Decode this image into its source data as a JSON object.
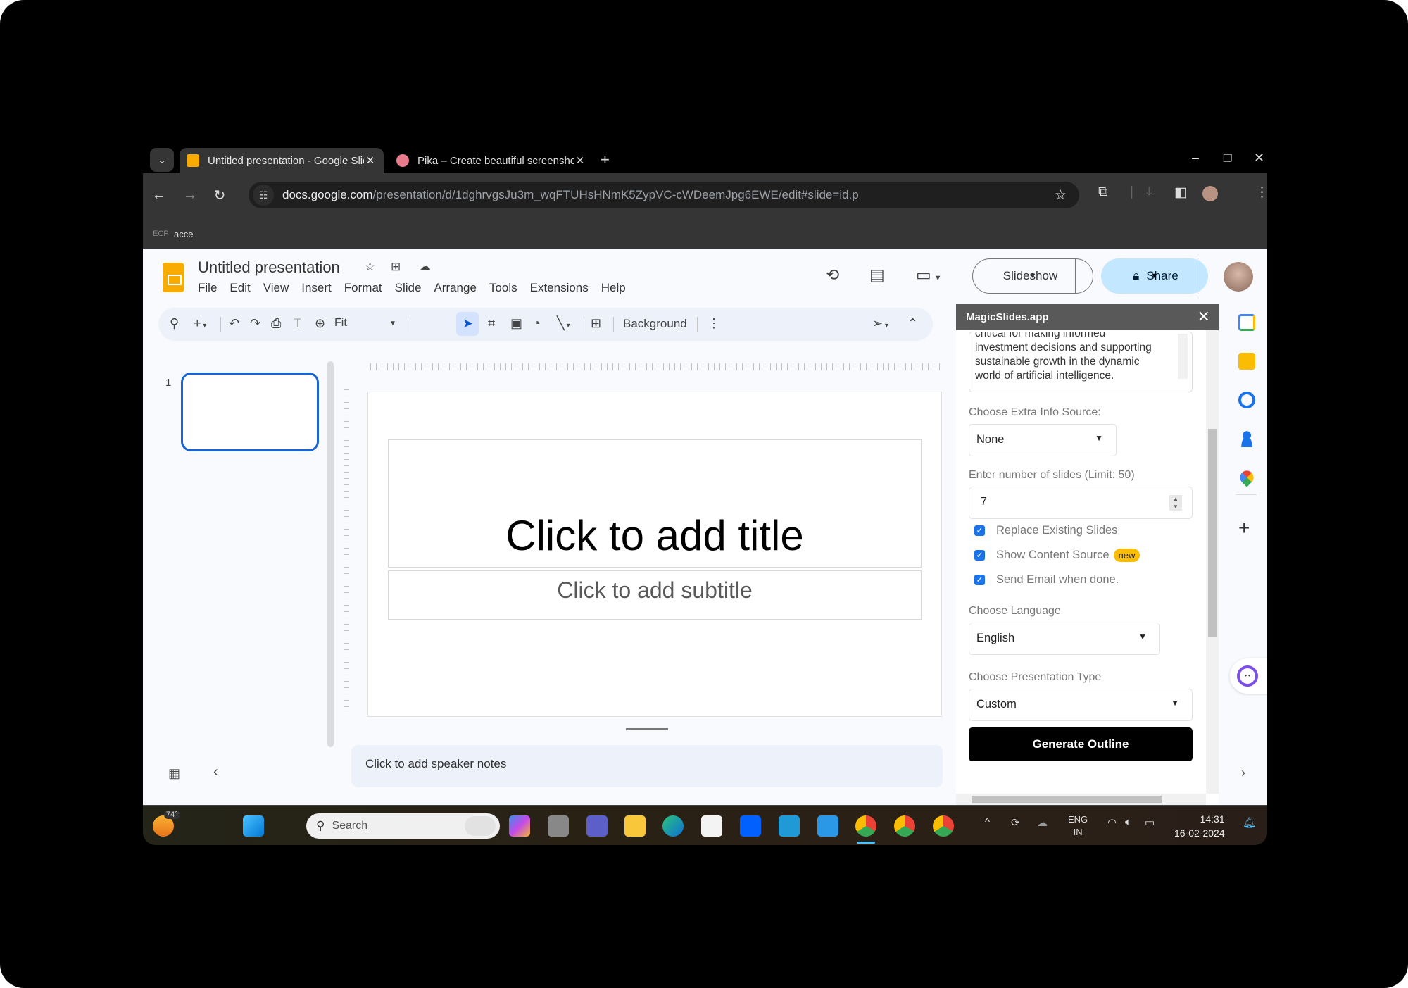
{
  "browser": {
    "tabs": [
      {
        "title": "Untitled presentation - Google Slides",
        "active": true,
        "favicon_color": "#f9ab00"
      },
      {
        "title": "Pika – Create beautiful screenshots",
        "active": false,
        "favicon_color": "#e97a8c"
      }
    ],
    "new_tab_label": "+",
    "url_host": "docs.google.com",
    "url_path": "/presentation/d/1dghrvgsJu3m_wqFTUHsHNmK5ZypVC-cWDeemJpg6EWE/edit#slide=id.p",
    "bookmark": {
      "icon": "ECP",
      "label": "acce"
    }
  },
  "slides": {
    "doc_title": "Untitled presentation",
    "menu": [
      "File",
      "Edit",
      "View",
      "Insert",
      "Format",
      "Slide",
      "Arrange",
      "Tools",
      "Extensions",
      "Help"
    ],
    "slideshow_label": "Slideshow",
    "share_label": "Share",
    "zoom_value": "Fit",
    "background_label": "Background",
    "slide_number": "1",
    "title_placeholder": "Click to add title",
    "subtitle_placeholder": "Click to add subtitle",
    "notes_placeholder": "Click to add speaker notes"
  },
  "magicslides": {
    "header": "MagicSlides.app",
    "textarea_lines": [
      "critical for making informed",
      "investment decisions and supporting",
      "sustainable growth in the dynamic",
      "world of artificial intelligence."
    ],
    "extra_info_label": "Choose Extra Info Source:",
    "extra_info_value": "None",
    "slides_count_label": "Enter number of slides (Limit: 50)",
    "slides_count_value": "7",
    "checkboxes": [
      {
        "label": "Replace Existing Slides",
        "checked": true
      },
      {
        "label": "Show Content Source",
        "checked": true,
        "badge": "new"
      },
      {
        "label": "Send Email when done.",
        "checked": true
      }
    ],
    "language_label": "Choose Language",
    "language_value": "English",
    "type_label": "Choose Presentation Type",
    "type_value": "Custom",
    "generate_label": "Generate Outline"
  },
  "taskbar": {
    "weather": "74°",
    "search_placeholder": "Search",
    "lang_top": "ENG",
    "lang_bottom": "IN",
    "time": "14:31",
    "date": "16-02-2024"
  }
}
